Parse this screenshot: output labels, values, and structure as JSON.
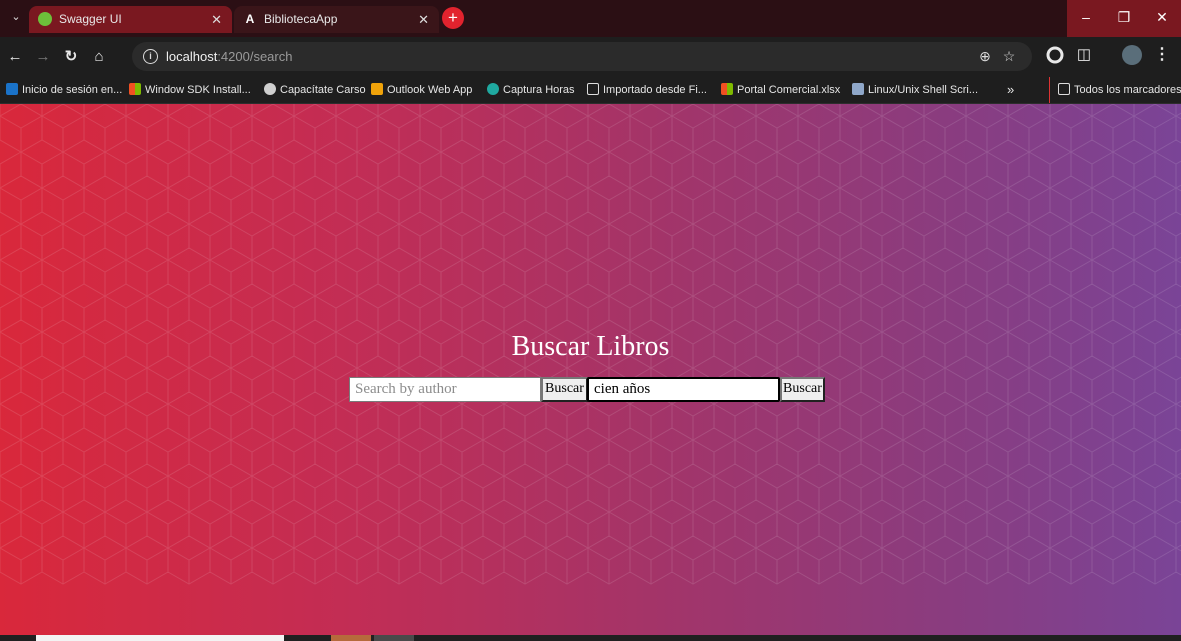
{
  "browser": {
    "tabs": [
      {
        "title": "Swagger UI",
        "active": true
      },
      {
        "title": "BibliotecaApp",
        "active": false
      }
    ],
    "address": {
      "host": "localhost",
      "path": ":4200/search"
    },
    "bookmarks": [
      "Inicio de sesión en...",
      "Window SDK Install...",
      "Capacítate Carso",
      "Outlook Web App",
      "Captura Horas",
      "Importado desde Fi...",
      "Portal Comercial.xlsx",
      "Linux/Unix Shell Scri..."
    ],
    "all_bookmarks_label": "Todos los marcadores",
    "overflow_label": "»"
  },
  "page": {
    "title": "Buscar Libros",
    "author_search": {
      "placeholder": "Search by author",
      "value": "",
      "button_label": "Buscar"
    },
    "title_search": {
      "value": "cien años",
      "button_label": "Buscar"
    }
  },
  "colors": {
    "gradient_start": "#d9283b",
    "gradient_end": "#7a4497",
    "new_tab_button": "#e2232e"
  }
}
